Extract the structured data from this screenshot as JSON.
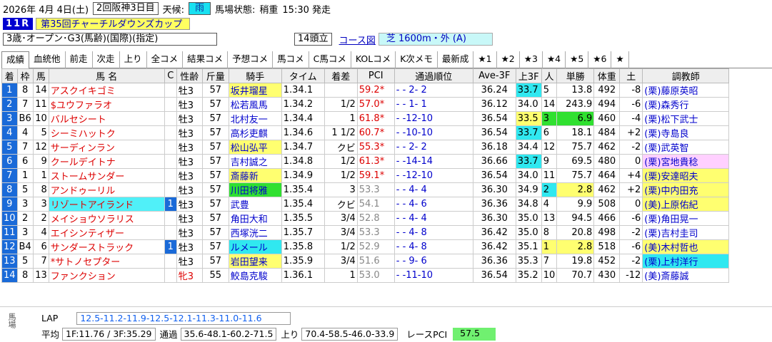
{
  "header": {
    "date": "2026年  4月  4日(土)",
    "meeting": "2回阪神3日目",
    "weather_label": "天候:",
    "weather": "雨",
    "track_label": "馬場状態:",
    "track": "稍重",
    "post_time": "15:30 発走"
  },
  "race": {
    "number": "11R",
    "name": "第35回チャーチルダウンズカップ",
    "conditions": "3歳･オープン･G3(馬齢)(国際)(指定)",
    "heads": "14頭立",
    "course_link": "コース図",
    "distance": "芝 1600m・外 (A)"
  },
  "tabs": [
    "成績",
    "血統他",
    "前走",
    "次走",
    "上り",
    "全コメ",
    "結果コメ",
    "予想コメ",
    "馬コメ",
    "C馬コメ",
    "KOLコメ",
    "K次メモ",
    "最新成",
    "★1",
    "★2",
    "★3",
    "★4",
    "★5",
    "★6",
    "★"
  ],
  "columns": [
    "着",
    "枠",
    "馬",
    "馬 名",
    "C",
    "性齢",
    "斤量",
    "騎手",
    "タイム",
    "着差",
    "PCI",
    "通過順位",
    "Ave-3F",
    "上3F",
    "人",
    "単勝",
    "体重",
    "土",
    "調教師"
  ],
  "rows": [
    {
      "pos": "1",
      "waku": "8",
      "num": "14",
      "name": "アスクイキゴミ",
      "c": "",
      "sex": "牡3",
      "kin": "57",
      "jockey": "坂井瑠星",
      "time": "1.34.1",
      "diff": "",
      "pci": "59.2*",
      "pass": "-   -  2-  2",
      "ave": "36.24",
      "up": "33.7",
      "ninki": "5",
      "odds": "13.8",
      "wt": "492",
      "chg": "-8",
      "trainer": "(栗)藤原英昭"
    },
    {
      "pos": "2",
      "waku": "7",
      "num": "11",
      "name": "$ユウファラオ",
      "c": "",
      "sex": "牡3",
      "kin": "57",
      "jockey": "松若風馬",
      "time": "1.34.2",
      "diff": "1/2",
      "pci": "57.0*",
      "pass": "-   -  1-  1",
      "ave": "36.12",
      "up": "34.0",
      "ninki": "14",
      "odds": "243.9",
      "wt": "494",
      "chg": "-6",
      "trainer": "(栗)森秀行"
    },
    {
      "pos": "3",
      "waku": "B6",
      "num": "10",
      "name": "バルセシート",
      "c": "",
      "sex": "牡3",
      "kin": "57",
      "jockey": "北村友一",
      "time": "1.34.4",
      "diff": "1",
      "pci": "61.8*",
      "pass": "-   -12-10",
      "ave": "36.54",
      "up": "33.5",
      "ninki": "3",
      "odds": "6.9",
      "wt": "460",
      "chg": "-4",
      "trainer": "(栗)松下武士"
    },
    {
      "pos": "4",
      "waku": "4",
      "num": "5",
      "name": "シーミハットク",
      "c": "",
      "sex": "牡3",
      "kin": "57",
      "jockey": "高杉吏麒",
      "time": "1.34.6",
      "diff": "1 1/2",
      "pci": "60.7*",
      "pass": "-   -10-10",
      "ave": "36.54",
      "up": "33.7",
      "ninki": "6",
      "odds": "18.1",
      "wt": "484",
      "chg": "+2",
      "trainer": "(栗)寺島良"
    },
    {
      "pos": "5",
      "waku": "7",
      "num": "12",
      "name": "サーディンラン",
      "c": "",
      "sex": "牡3",
      "kin": "57",
      "jockey": "松山弘平",
      "time": "1.34.7",
      "diff": "クビ",
      "pci": "55.3*",
      "pass": "-   -  2-  2",
      "ave": "36.18",
      "up": "34.4",
      "ninki": "12",
      "odds": "75.7",
      "wt": "462",
      "chg": "-2",
      "trainer": "(栗)武英智"
    },
    {
      "pos": "6",
      "waku": "6",
      "num": "9",
      "name": "クールデイトナ",
      "c": "",
      "sex": "牡3",
      "kin": "57",
      "jockey": "吉村誠之",
      "time": "1.34.8",
      "diff": "1/2",
      "pci": "61.3*",
      "pass": "-   -14-14",
      "ave": "36.66",
      "up": "33.7",
      "ninki": "9",
      "odds": "69.5",
      "wt": "480",
      "chg": "0",
      "trainer": "(栗)宮地貴稔"
    },
    {
      "pos": "7",
      "waku": "1",
      "num": "1",
      "name": "ストームサンダー",
      "c": "",
      "sex": "牡3",
      "kin": "57",
      "jockey": "斎藤新",
      "time": "1.34.9",
      "diff": "1/2",
      "pci": "59.1*",
      "pass": "-   -12-10",
      "ave": "36.54",
      "up": "34.0",
      "ninki": "11",
      "odds": "75.7",
      "wt": "464",
      "chg": "+4",
      "trainer": "(栗)安達昭夫"
    },
    {
      "pos": "8",
      "waku": "5",
      "num": "8",
      "name": "アンドゥーリル",
      "c": "",
      "sex": "牡3",
      "kin": "57",
      "jockey": "川田将雅",
      "time": "1.35.4",
      "diff": "3",
      "pci": "53.3",
      "pass": "-   -  4-  4",
      "ave": "36.30",
      "up": "34.9",
      "ninki": "2",
      "odds": "2.8",
      "wt": "462",
      "chg": "+2",
      "trainer": "(栗)中内田充"
    },
    {
      "pos": "9",
      "waku": "3",
      "num": "3",
      "name": "リゾートアイランド",
      "c": "1",
      "sex": "牡3",
      "kin": "57",
      "jockey": "武豊",
      "time": "1.35.4",
      "diff": "クビ",
      "pci": "54.1",
      "pass": "-   -  4-  6",
      "ave": "36.36",
      "up": "34.8",
      "ninki": "4",
      "odds": "9.9",
      "wt": "508",
      "chg": "0",
      "trainer": "(美)上原佑紀"
    },
    {
      "pos": "10",
      "waku": "2",
      "num": "2",
      "name": "メイショウソラリス",
      "c": "",
      "sex": "牡3",
      "kin": "57",
      "jockey": "角田大和",
      "time": "1.35.5",
      "diff": "3/4",
      "pci": "52.8",
      "pass": "-   -  4-  4",
      "ave": "36.30",
      "up": "35.0",
      "ninki": "13",
      "odds": "94.5",
      "wt": "466",
      "chg": "-6",
      "trainer": "(栗)角田晃一"
    },
    {
      "pos": "11",
      "waku": "3",
      "num": "4",
      "name": "エイシンティザー",
      "c": "",
      "sex": "牡3",
      "kin": "57",
      "jockey": "西塚洸二",
      "time": "1.35.7",
      "diff": "3/4",
      "pci": "53.3",
      "pass": "-   -  4-  8",
      "ave": "36.42",
      "up": "35.0",
      "ninki": "8",
      "odds": "20.8",
      "wt": "498",
      "chg": "-2",
      "trainer": "(栗)吉村圭司"
    },
    {
      "pos": "12",
      "waku": "B4",
      "num": "6",
      "name": "サンダーストラック",
      "c": "1",
      "sex": "牡3",
      "kin": "57",
      "jockey": "ルメール",
      "time": "1.35.8",
      "diff": "1/2",
      "pci": "52.9",
      "pass": "-   -  4-  8",
      "ave": "36.42",
      "up": "35.1",
      "ninki": "1",
      "odds": "2.8",
      "wt": "518",
      "chg": "-6",
      "trainer": "(美)木村哲也"
    },
    {
      "pos": "13",
      "waku": "5",
      "num": "7",
      "name": "*サトノセプター",
      "c": "",
      "sex": "牡3",
      "kin": "57",
      "jockey": "岩田望来",
      "time": "1.35.9",
      "diff": "3/4",
      "pci": "51.6",
      "pass": "-   -  9-  6",
      "ave": "36.36",
      "up": "35.3",
      "ninki": "7",
      "odds": "19.8",
      "wt": "452",
      "chg": "-2",
      "trainer": "(栗)上村洋行"
    },
    {
      "pos": "14",
      "waku": "8",
      "num": "13",
      "name": "ファンクション",
      "c": "",
      "sex": "牝3",
      "kin": "55",
      "jockey": "鮫島克駿",
      "time": "1.36.1",
      "diff": "1",
      "pci": "53.0",
      "pass": "-   -11-10",
      "ave": "36.54",
      "up": "35.2",
      "ninki": "10",
      "odds": "70.7",
      "wt": "430",
      "chg": "-12",
      "trainer": "(美)斎藤誠"
    }
  ],
  "bottom": {
    "side_label": "馬場",
    "lap_label": "LAP",
    "lap": "12.5-11.2-11.9-12.5-12.1-11.3-11.0-11.6",
    "avg_label": "平均",
    "avg": "1F:11.76 / 3F:35.29",
    "pass_label": "通過",
    "pass": "35.6-48.1-60.2-71.5",
    "up_label": "上り",
    "up": "70.4-58.5-46.0-33.9",
    "pci_label": "レースPCI",
    "pci": "57.5"
  },
  "colors": {
    "pos_bg": "#1a6ad8",
    "highlight_yellow": "#ffff70",
    "highlight_green": "#30e030",
    "highlight_cyan": "#30e8f0"
  }
}
